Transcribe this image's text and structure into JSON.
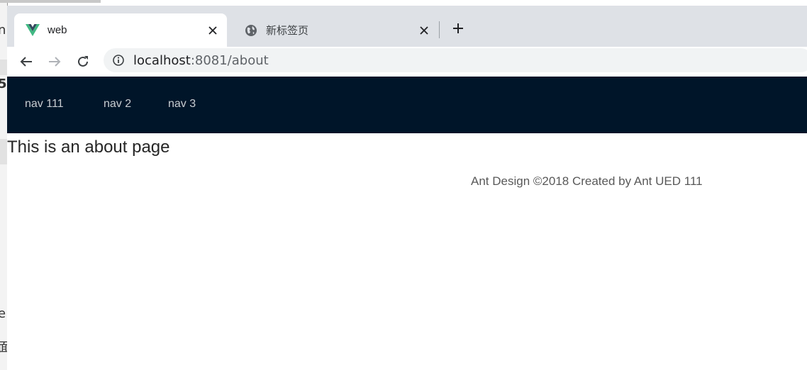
{
  "browser": {
    "tabs": [
      {
        "title": "web",
        "icon": "vue-logo-icon",
        "active": true
      },
      {
        "title": "新标签页",
        "icon": "globe-icon",
        "active": false
      }
    ],
    "address": {
      "host": "localhost",
      "rest": ":8081/about"
    }
  },
  "nav": {
    "items": [
      {
        "label": "nav 111"
      },
      {
        "label": "nav 2"
      },
      {
        "label": "nav 3"
      }
    ]
  },
  "content": {
    "title": "This is an about page"
  },
  "footer": {
    "text": "Ant Design ©2018 Created by Ant UED 111"
  },
  "colors": {
    "header_bg": "#001529",
    "vue_green": "#41b883",
    "vue_dark": "#34495e"
  }
}
